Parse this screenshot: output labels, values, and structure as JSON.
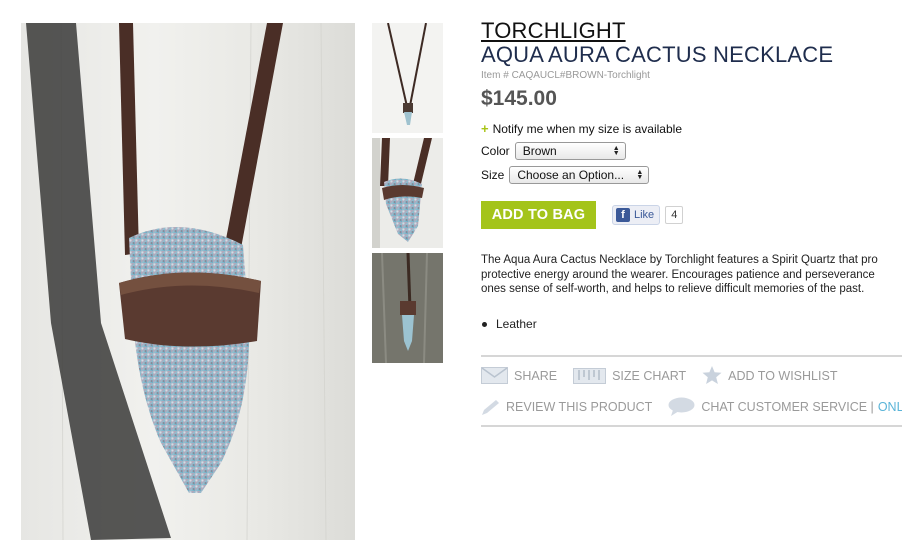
{
  "product": {
    "brand": "TORCHLIGHT",
    "title": "AQUA AURA CACTUS NECKLACE",
    "item_number": "Item # CAQAUCL#BROWN-Torchlight",
    "price": "$145.00",
    "notify_plus": "+",
    "notify_text": "Notify me when my size is available"
  },
  "options": {
    "color_label": "Color",
    "color_value": "Brown",
    "size_label": "Size",
    "size_value": "Choose an Option..."
  },
  "buy": {
    "add_to_bag": "ADD TO BAG",
    "fb_icon": "f",
    "like_label": "Like",
    "like_count": "4"
  },
  "description": {
    "line1": "The Aqua Aura Cactus Necklace by Torchlight features a Spirit Quartz that pro",
    "line2": "protective energy around the wearer. Encourages patience and perseverance",
    "line3": "ones sense of self-worth, and helps to relieve difficult memories of the past."
  },
  "materials": [
    "Leather"
  ],
  "actions": {
    "share": "SHARE",
    "size_chart": "SIZE CHART",
    "add_to_wishlist": "ADD TO WISHLIST",
    "review": "REVIEW THIS PRODUCT",
    "chat": "CHAT CUSTOMER SERVICE |",
    "online": "ONLINE"
  },
  "icons": {
    "share": "envelope-icon",
    "size_chart": "ruler-icon",
    "wishlist": "star-icon",
    "review": "pencil-icon",
    "chat": "speech-bubble-icon"
  },
  "colors": {
    "add_to_bag": "#a4c41a",
    "title": "#1f2d4d",
    "online": "#5ab4d8",
    "facebook": "#3b5998"
  }
}
